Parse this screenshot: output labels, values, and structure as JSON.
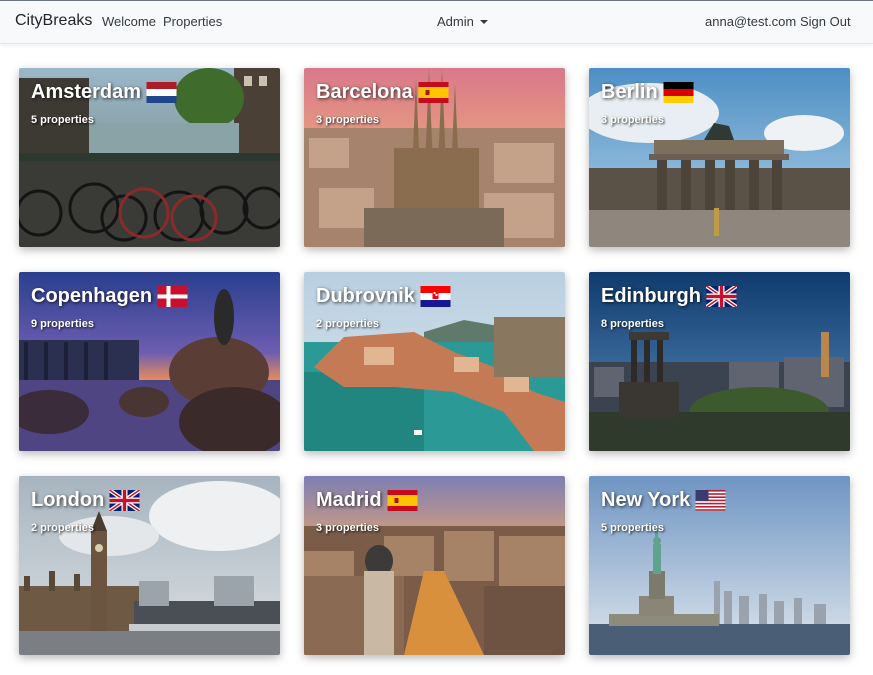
{
  "navbar": {
    "brand": "CityBreaks",
    "links": [
      "Welcome",
      "Properties"
    ],
    "admin_label": "Admin",
    "user_email": "anna@test.com",
    "sign_out": "Sign Out"
  },
  "cities": [
    {
      "name": "Amsterdam",
      "properties": "5 properties",
      "flag_icon": "netherlands-flag-icon"
    },
    {
      "name": "Barcelona",
      "properties": "3 properties",
      "flag_icon": "spain-flag-icon"
    },
    {
      "name": "Berlin",
      "properties": "3 properties",
      "flag_icon": "germany-flag-icon"
    },
    {
      "name": "Copenhagen",
      "properties": "9 properties",
      "flag_icon": "denmark-flag-icon"
    },
    {
      "name": "Dubrovnik",
      "properties": "2 properties",
      "flag_icon": "croatia-flag-icon"
    },
    {
      "name": "Edinburgh",
      "properties": "8 properties",
      "flag_icon": "uk-flag-icon"
    },
    {
      "name": "London",
      "properties": "2 properties",
      "flag_icon": "uk-flag-icon"
    },
    {
      "name": "Madrid",
      "properties": "3 properties",
      "flag_icon": "spain-flag-icon"
    },
    {
      "name": "New York",
      "properties": "5 properties",
      "flag_icon": "usa-flag-icon"
    }
  ]
}
